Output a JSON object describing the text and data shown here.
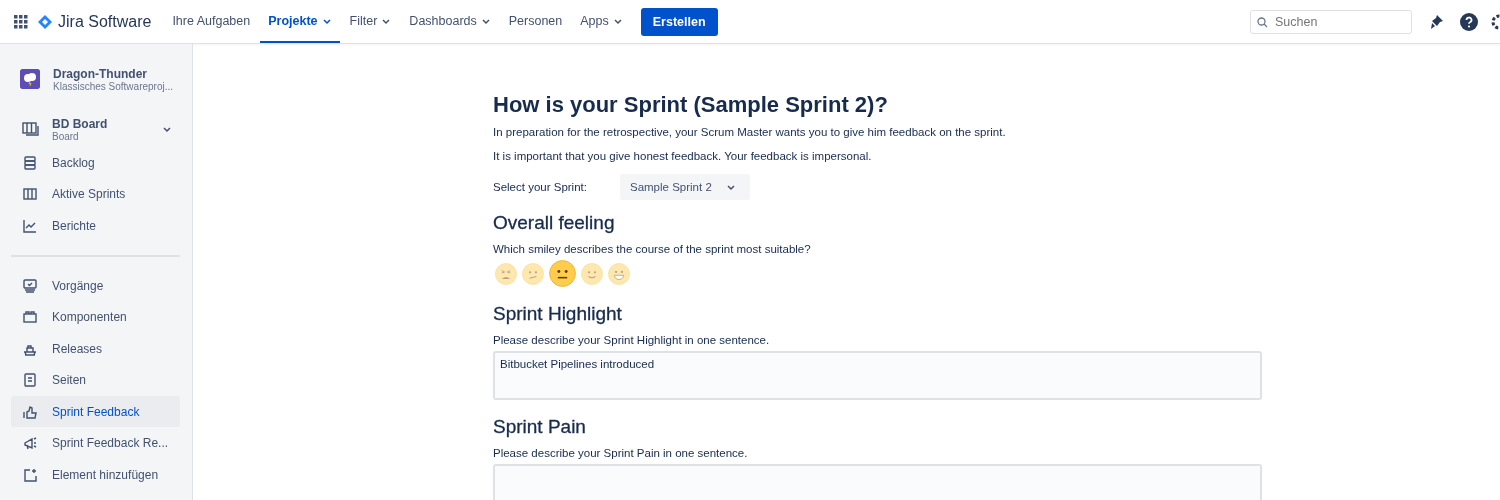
{
  "topbar": {
    "product": "Jira Software",
    "nav": [
      {
        "label": "Ihre Aufgaben",
        "dropdown": false,
        "selected": false
      },
      {
        "label": "Projekte",
        "dropdown": true,
        "selected": true
      },
      {
        "label": "Filter",
        "dropdown": true,
        "selected": false
      },
      {
        "label": "Dashboards",
        "dropdown": true,
        "selected": false
      },
      {
        "label": "Personen",
        "dropdown": false,
        "selected": false
      },
      {
        "label": "Apps",
        "dropdown": true,
        "selected": false
      }
    ],
    "create_button": "Erstellen",
    "search": {
      "placeholder": "Suchen"
    }
  },
  "sidebar": {
    "project": {
      "name": "Dragon-Thunder",
      "type": "Klassisches Softwareproj..."
    },
    "board": {
      "name": "BD Board",
      "subtitle": "Board"
    },
    "groups": [
      [
        {
          "label": "Backlog",
          "selected": false
        },
        {
          "label": "Aktive Sprints",
          "selected": false
        },
        {
          "label": "Berichte",
          "selected": false
        }
      ],
      [
        {
          "label": "Vorgänge",
          "selected": false
        },
        {
          "label": "Komponenten",
          "selected": false
        },
        {
          "label": "Releases",
          "selected": false
        },
        {
          "label": "Seiten",
          "selected": false
        },
        {
          "label": "Sprint Feedback",
          "selected": true
        },
        {
          "label": "Sprint Feedback Re...",
          "selected": false
        },
        {
          "label": "Element hinzufügen",
          "selected": false
        }
      ]
    ]
  },
  "form": {
    "title": "How is your Sprint (Sample Sprint 2)?",
    "intro": [
      "In preparation for the retrospective, your Scrum Master wants you to give him feedback on the sprint.",
      "It is important that you give honest feedback. Your feedback is impersonal."
    ],
    "sprint_select": {
      "label": "Select your Sprint:",
      "value": "Sample Sprint 2"
    },
    "overall": {
      "heading": "Overall feeling",
      "question": "Which smiley describes the course of the sprint most suitable?",
      "smileys": [
        {
          "kind": "tired",
          "selected": false
        },
        {
          "kind": "confused",
          "selected": false
        },
        {
          "kind": "neutral",
          "selected": true
        },
        {
          "kind": "slight",
          "selected": false
        },
        {
          "kind": "grin",
          "selected": false
        }
      ]
    },
    "sections": [
      {
        "heading": "Sprint Highlight",
        "question": "Please describe your Sprint Highlight in one sentence.",
        "value": "Bitbucket Pipelines introduced"
      },
      {
        "heading": "Sprint Pain",
        "question": "Please describe your Sprint Pain in one sentence."
      }
    ]
  }
}
